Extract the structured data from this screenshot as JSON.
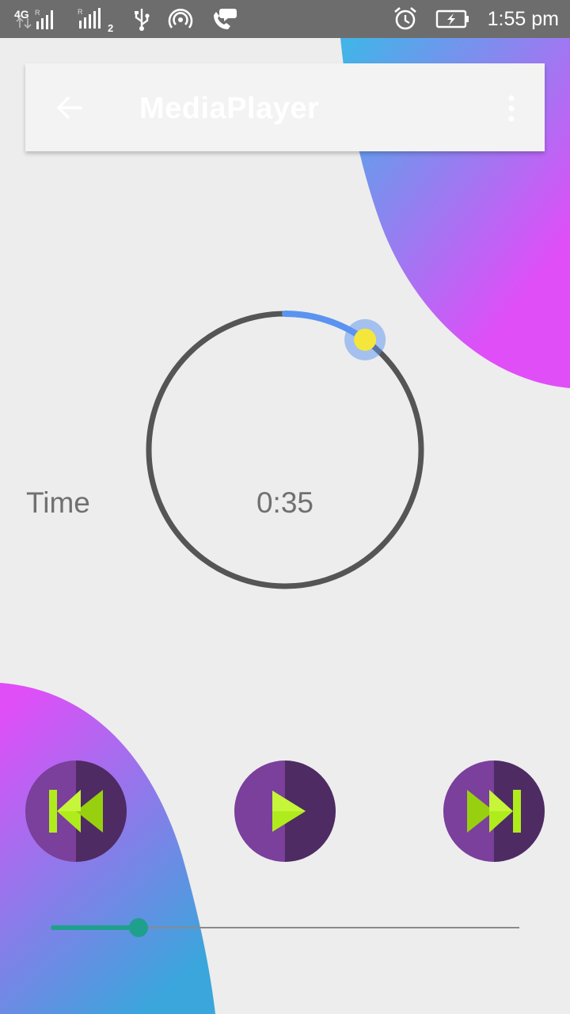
{
  "status_bar": {
    "network_label": "4G",
    "roaming_1": "R",
    "roaming_2": "R",
    "sim2_label": "2",
    "time": "1:55 pm",
    "icons": [
      "signal-icon",
      "usb-icon",
      "hotspot-icon",
      "call-chat-icon",
      "alarm-icon",
      "battery-charging-icon"
    ]
  },
  "toolbar": {
    "title": "MediaPlayer",
    "back_icon": "arrow-back-icon",
    "overflow_icon": "more-vert-icon"
  },
  "player": {
    "time_label": "Time",
    "elapsed": "0:35",
    "dial_progress_fraction": 0.1,
    "seek_progress_fraction": 0.187,
    "controls": [
      {
        "name": "previous",
        "icon": "skip-previous-icon"
      },
      {
        "name": "play",
        "icon": "play-icon"
      },
      {
        "name": "next",
        "icon": "skip-next-icon"
      }
    ]
  },
  "colors": {
    "accent_blue": "#5a93f0",
    "knob_yellow": "#f5e63c",
    "ring_gray": "#555555",
    "button_purple_light": "#7b3f9c",
    "button_purple_dark": "#4e2b63",
    "icon_green": "#b0ec1c",
    "seek_teal": "#1fa08d",
    "gradient_magenta": "#e04ef8",
    "gradient_blue": "#45b2e8"
  }
}
